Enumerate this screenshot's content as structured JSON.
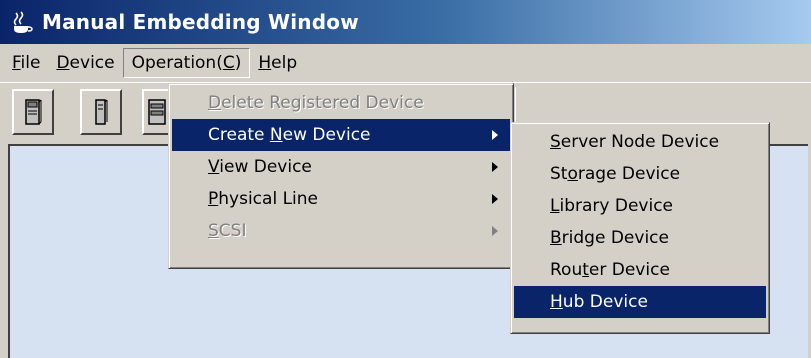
{
  "window": {
    "title": "Manual Embedding Window"
  },
  "menubar": {
    "file": {
      "pre": "",
      "ul": "F",
      "post": "ile"
    },
    "device": {
      "pre": "",
      "ul": "D",
      "post": "evice"
    },
    "operation": {
      "pre": "Operation(",
      "ul": "C",
      "post": ")"
    },
    "help": {
      "pre": "",
      "ul": "H",
      "post": "elp"
    }
  },
  "operation_menu": {
    "delete": {
      "pre": "",
      "ul": "D",
      "post": "elete Registered Device"
    },
    "create": {
      "pre": "Create ",
      "ul": "N",
      "post": "ew Device"
    },
    "view": {
      "pre": "",
      "ul": "V",
      "post": "iew Device"
    },
    "physical": {
      "pre": "",
      "ul": "P",
      "post": "hysical Line"
    },
    "scsi": {
      "pre": "",
      "ul": "S",
      "post": "CSI"
    }
  },
  "create_submenu": {
    "server": {
      "pre": "",
      "ul": "S",
      "post": "erver Node Device"
    },
    "storage": {
      "pre": "St",
      "ul": "o",
      "post": "rage Device"
    },
    "library": {
      "pre": "",
      "ul": "L",
      "post": "ibrary Device"
    },
    "bridge": {
      "pre": "",
      "ul": "B",
      "post": "ridge Device"
    },
    "router": {
      "pre": "Rou",
      "ul": "t",
      "post": "er Device"
    },
    "hub": {
      "pre": "",
      "ul": "H",
      "post": "ub Device"
    }
  },
  "icons": {
    "app": "coffee-cup-icon",
    "toolbar": [
      "server-device-icon",
      "storage-device-icon",
      "library-device-icon"
    ]
  },
  "colors": {
    "highlight": "#0a246a",
    "canvas": "#d6e1f1"
  }
}
